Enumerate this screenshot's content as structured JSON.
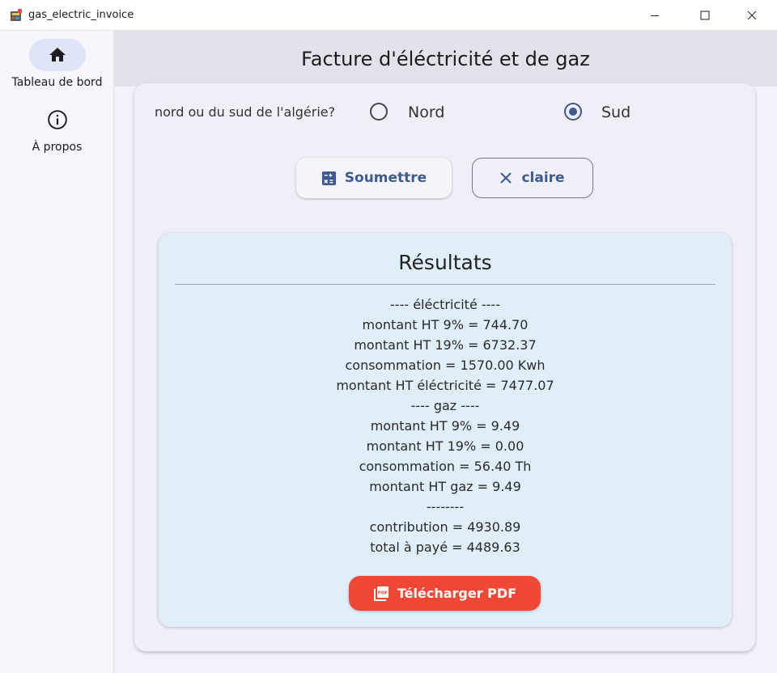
{
  "window": {
    "title": "gas_electric_invoice"
  },
  "nav": {
    "items": [
      {
        "label": "Tableau de bord",
        "icon": "home-icon",
        "selected": true
      },
      {
        "label": "À propos",
        "icon": "info-icon",
        "selected": false
      }
    ]
  },
  "appbar": {
    "title": "Facture d'éléctricité et de gaz"
  },
  "form": {
    "question": "nord ou du sud de l'algérie?",
    "options": [
      {
        "label": "Nord",
        "selected": false
      },
      {
        "label": "Sud",
        "selected": true
      }
    ],
    "submit_label": "Soumettre",
    "clear_label": "claire"
  },
  "results": {
    "title": "Résultats",
    "lines": [
      "---- éléctricité ----",
      "montant HT 9% = 744.70",
      "montant HT 19% = 6732.37",
      "consommation = 1570.00 Kwh",
      "montant HT éléctricité = 7477.07",
      "---- gaz ----",
      "montant HT 9% = 9.49",
      "montant HT 19% = 0.00",
      "consommation = 56.40 Th",
      "montant HT gaz = 9.49",
      "--------",
      "contribution = 4930.89",
      "total à payé = 4489.63"
    ],
    "pdf_label": "Télécharger PDF"
  },
  "colors": {
    "accent": "#3d5b8e",
    "pdf_button": "#f14836",
    "results_bg": "#e0eef9",
    "appbar_bg": "#e2e2ea",
    "rail_active": "#dfe3f6"
  }
}
